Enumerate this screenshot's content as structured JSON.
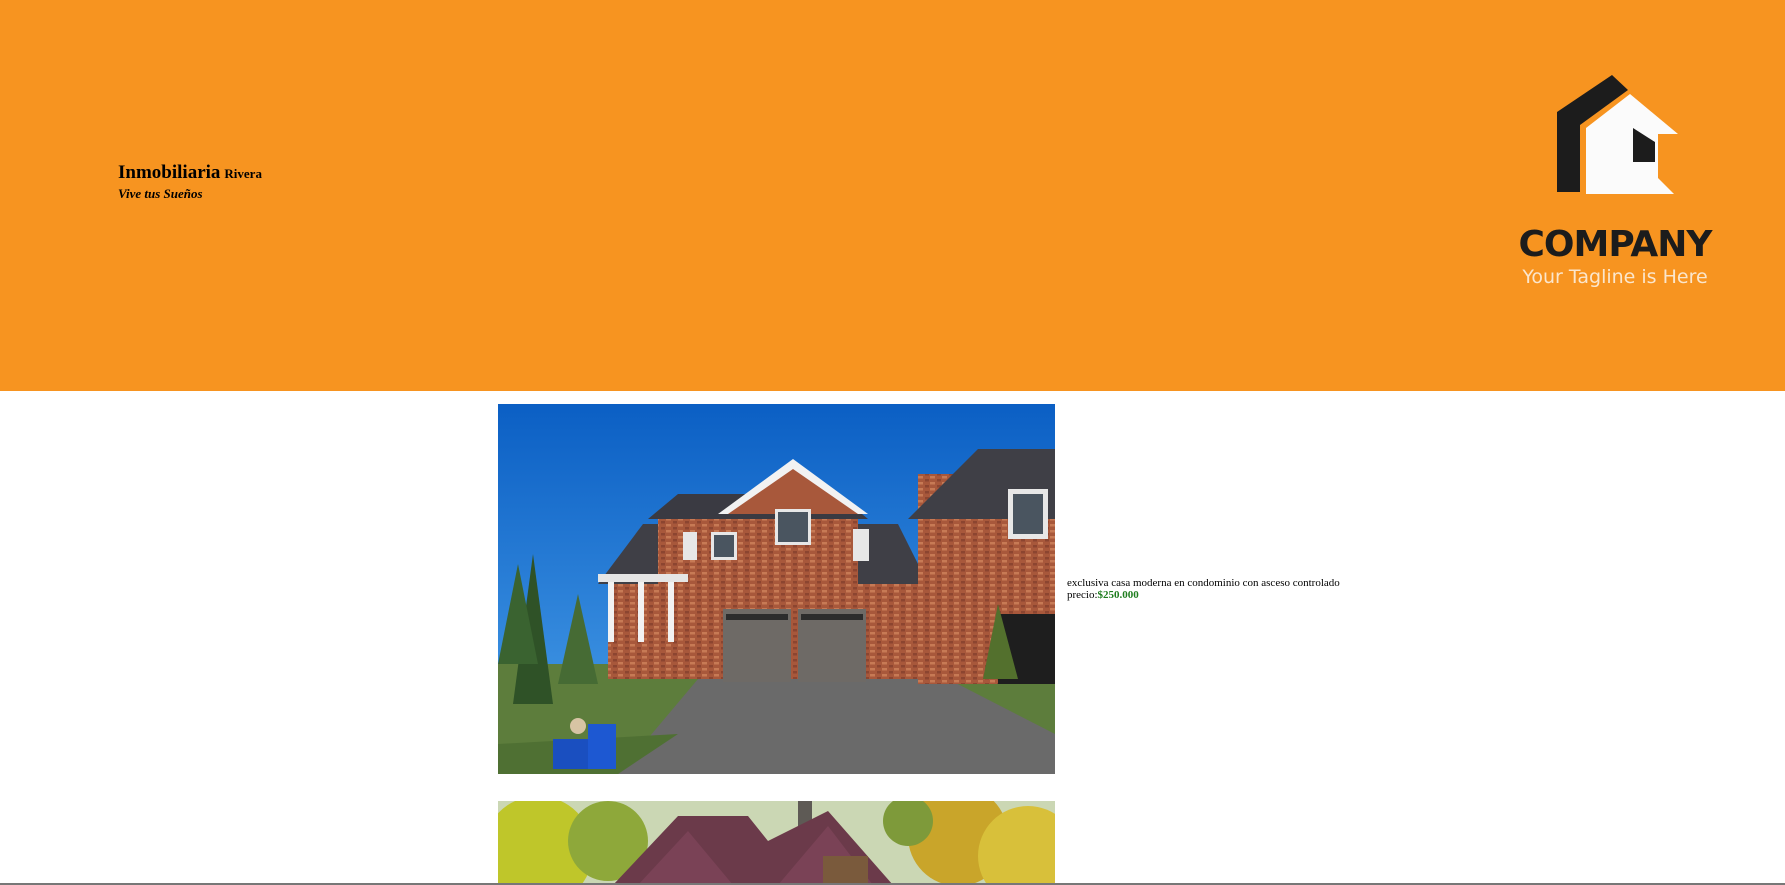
{
  "header": {
    "brand_name": "Inmobiliaria",
    "brand_suffix": "Rivera",
    "tagline": "Vive tus Sueños",
    "background_color": "#f79420"
  },
  "logo": {
    "icon": "house-logo-icon",
    "wordmark": "COMPANY",
    "tagline": "Your Tagline is Here"
  },
  "listings": [
    {
      "photo": "house-photo-brick-two-car-garage",
      "description": "exclusiva casa moderna en condominio con asceso controlado",
      "price_label": "precio:",
      "price_value": "$250.000",
      "price_color": "#1e7d1e"
    },
    {
      "photo": "house-photo-wooden-cabin"
    }
  ]
}
